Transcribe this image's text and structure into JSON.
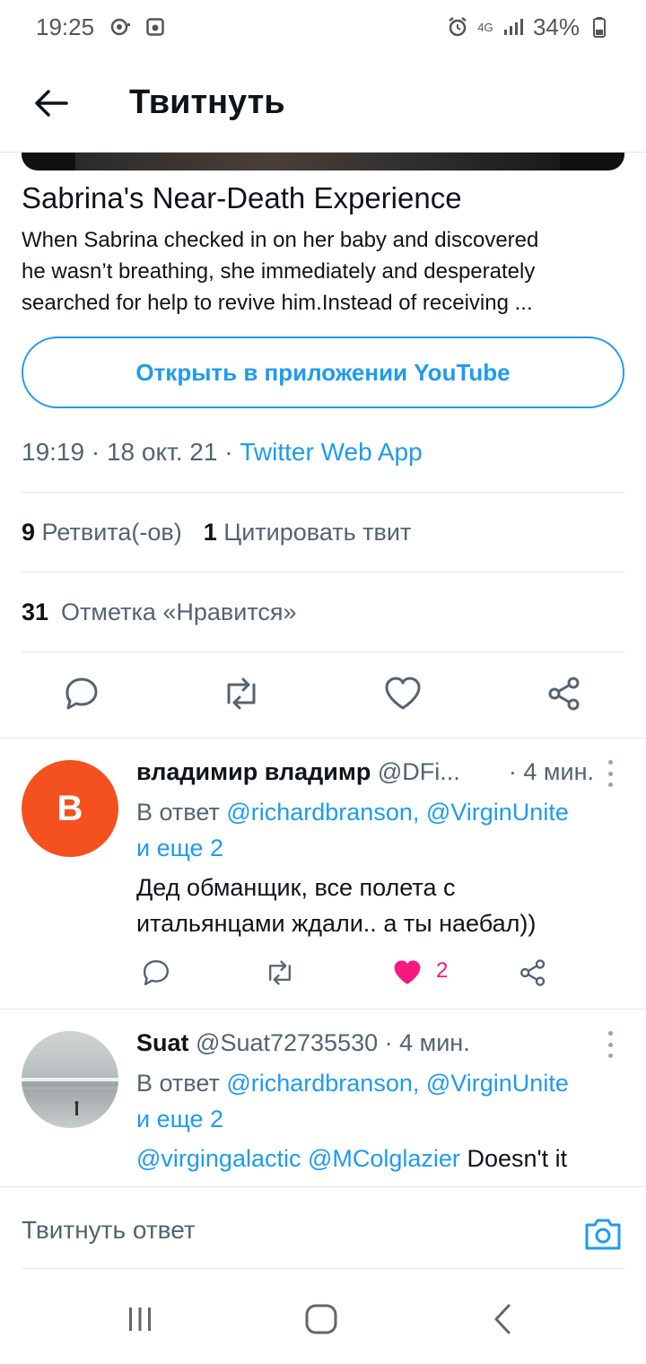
{
  "status_bar": {
    "time": "19:25",
    "network": "4G",
    "battery": "34%"
  },
  "header": {
    "title": "Твитнуть"
  },
  "card": {
    "title": "Sabrina's Near-Death Experience",
    "description_lines": [
      "When Sabrina checked in on her baby and discovered",
      "he wasn’t breathing, she immediately and desperately",
      "searched for help to revive him.Instead of receiving ..."
    ]
  },
  "open_button": {
    "label": "Открыть в приложении YouTube"
  },
  "meta": {
    "time": "19:19",
    "date": "18 окт. 21",
    "source": "Twitter Web App"
  },
  "stats": {
    "retweets_count": "9",
    "retweets_label": "Ретвита(-ов)",
    "quotes_count": "1",
    "quotes_label": "Цитировать твит",
    "likes_count": "31",
    "likes_label": "Отметка «Нравится»"
  },
  "replies": [
    {
      "avatar_letter": "В",
      "avatar_color": "#f4511e",
      "name": "владимир владимр",
      "handle": "@DFi...",
      "time": "· 4 мин.",
      "reply_prefix": "В ответ",
      "reply_mentions": "@richardbranson, @VirginUnite",
      "reply_more": "и еще 2",
      "text_lines": [
        "Дед обманщик, все полета с",
        "итальянцами ждали.. а ты наебал))"
      ],
      "like_count": "2"
    },
    {
      "name": "Suat",
      "handle": "@Suat72735530",
      "time": "· 4 мин.",
      "reply_prefix": "В ответ",
      "reply_mentions": "@richardbranson, @VirginUnite",
      "reply_more": "и еще 2",
      "text_mentions": "@virgingalactic @MColglazier",
      "text_rest": "Doesn't it"
    }
  ],
  "compose": {
    "placeholder": "Твитнуть ответ"
  },
  "colors": {
    "accent": "#1d9bf0",
    "like": "#f91880",
    "muted": "#536471"
  }
}
